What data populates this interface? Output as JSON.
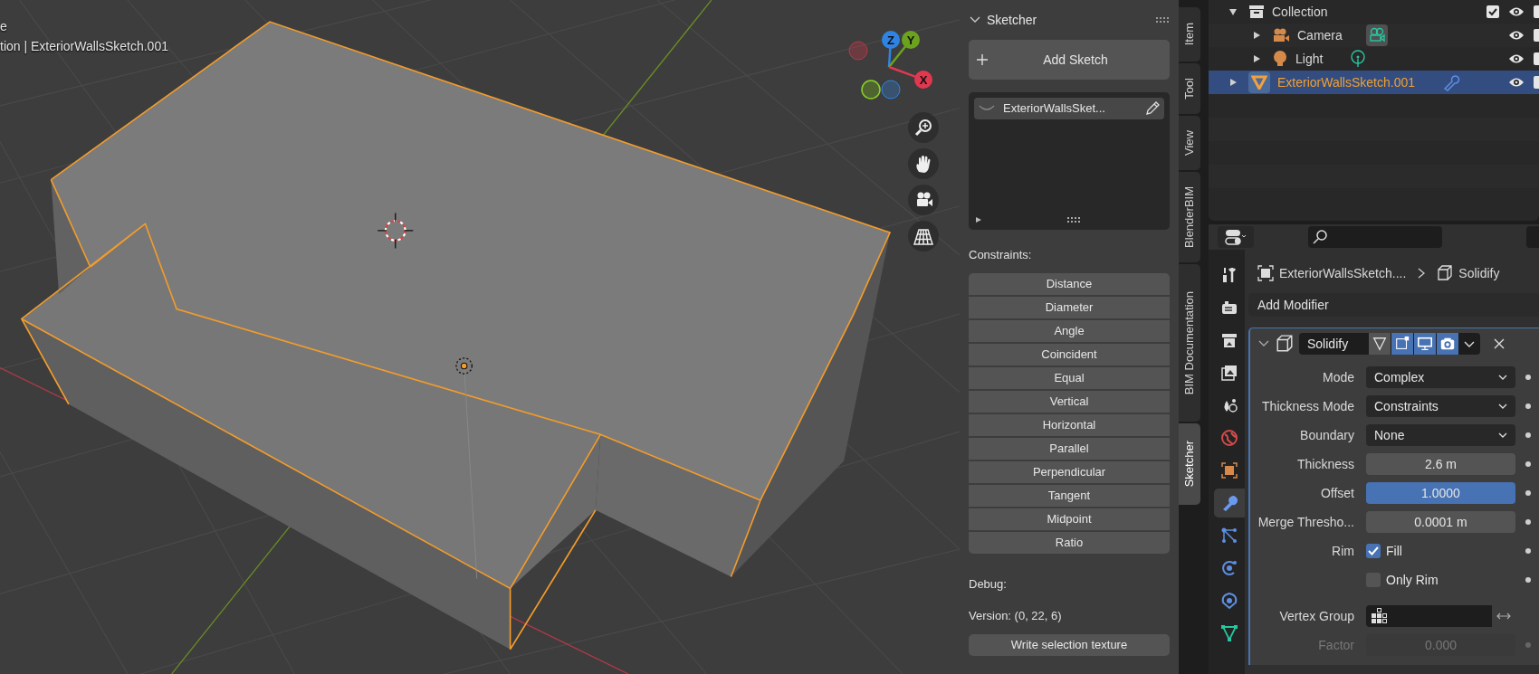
{
  "viewport": {
    "header_lines": [
      "e",
      "tion | ExteriorWallsSketch.001"
    ],
    "gizmo_axes": [
      {
        "label": "Z",
        "color": "#2f83e3"
      },
      {
        "label": "Y",
        "color": "#6ba31f"
      },
      {
        "label": "X",
        "color": "#e0384f"
      }
    ],
    "nav_buttons": [
      {
        "kind": "zoom"
      },
      {
        "kind": "pan"
      },
      {
        "kind": "camera"
      },
      {
        "kind": "ortho"
      }
    ]
  },
  "sketcher_panel": {
    "title": "Sketcher",
    "expanded": true,
    "add_button": "Add Sketch",
    "sketches": [
      {
        "name": "ExteriorWallsSket...",
        "selected": true
      }
    ],
    "constraints_label": "Constraints:",
    "constraints": [
      "Distance",
      "Diameter",
      "Angle",
      "Coincident",
      "Equal",
      "Vertical",
      "Horizontal",
      "Parallel",
      "Perpendicular",
      "Tangent",
      "Midpoint",
      "Ratio"
    ],
    "debug_label": "Debug:",
    "version": "Version: (0, 22, 6)",
    "debug_buttons": [
      "Write selection texture"
    ]
  },
  "sidebar_tabs": [
    {
      "label": "Item",
      "selected": false
    },
    {
      "label": "Tool",
      "selected": false
    },
    {
      "label": "View",
      "selected": false
    },
    {
      "label": "BlenderBIM",
      "selected": false
    },
    {
      "label": "BIM Documentation",
      "selected": false
    },
    {
      "label": "Sketcher",
      "selected": true
    }
  ],
  "outliner": {
    "items": [
      {
        "label": "Collection",
        "kind": "collection",
        "expanded": true,
        "selected": false,
        "checked": true,
        "children": [
          {
            "label": "Camera",
            "kind": "camera",
            "expanded": false,
            "selected": false
          },
          {
            "label": "Light",
            "kind": "light",
            "expanded": false,
            "selected": false
          }
        ]
      },
      {
        "label": "ExteriorWallsSketch.001",
        "kind": "mesh",
        "expanded": false,
        "selected": true
      }
    ]
  },
  "properties": {
    "tabs": [
      {
        "kind": "tool",
        "selected": false
      },
      {
        "kind": "render",
        "selected": false
      },
      {
        "kind": "output",
        "selected": false
      },
      {
        "kind": "view_layer",
        "selected": false
      },
      {
        "kind": "scene",
        "selected": false
      },
      {
        "kind": "world",
        "selected": false
      },
      {
        "kind": "object",
        "selected": false
      },
      {
        "kind": "modifiers",
        "selected": true
      },
      {
        "kind": "particles",
        "selected": false
      },
      {
        "kind": "physics",
        "selected": false
      },
      {
        "kind": "constraints",
        "selected": false
      },
      {
        "kind": "data",
        "selected": false
      }
    ],
    "breadcrumb": [
      "ExteriorWallsSketch....",
      "Solidify"
    ],
    "add_modifier": "Add Modifier",
    "modifier": {
      "name": "Solidify",
      "expanded": true,
      "toggles": [
        {
          "kind": "edit_mode",
          "on": false
        },
        {
          "kind": "on_cage",
          "on": true
        },
        {
          "kind": "viewport",
          "on": true
        },
        {
          "kind": "render",
          "on": true
        }
      ],
      "fields": [
        {
          "kind": "dropdown",
          "label": "Mode",
          "value": "Complex",
          "active": false,
          "disabled": false
        },
        {
          "kind": "dropdown",
          "label": "Thickness Mode",
          "value": "Constraints",
          "active": false,
          "disabled": false
        },
        {
          "kind": "dropdown",
          "label": "Boundary",
          "value": "None",
          "active": false,
          "disabled": false
        },
        {
          "kind": "number",
          "label": "Thickness",
          "value": "2.6 m",
          "active": false,
          "disabled": false
        },
        {
          "kind": "number",
          "label": "Offset",
          "value": "1.0000",
          "active": true,
          "disabled": false
        },
        {
          "kind": "number",
          "label": "Merge Thresho...",
          "value": "0.0001 m",
          "active": false,
          "disabled": false
        },
        {
          "kind": "checkbox",
          "label": "Rim",
          "text": "Fill",
          "checked": true,
          "active": false,
          "disabled": false
        },
        {
          "kind": "checkbox",
          "text": "Only Rim",
          "checked": false,
          "active": false,
          "disabled": false
        },
        {
          "kind": "vertex_group",
          "label": "Vertex Group",
          "active": false,
          "disabled": false
        },
        {
          "kind": "number",
          "label": "Factor",
          "value": "0.000",
          "active": false,
          "disabled": true
        }
      ]
    }
  }
}
